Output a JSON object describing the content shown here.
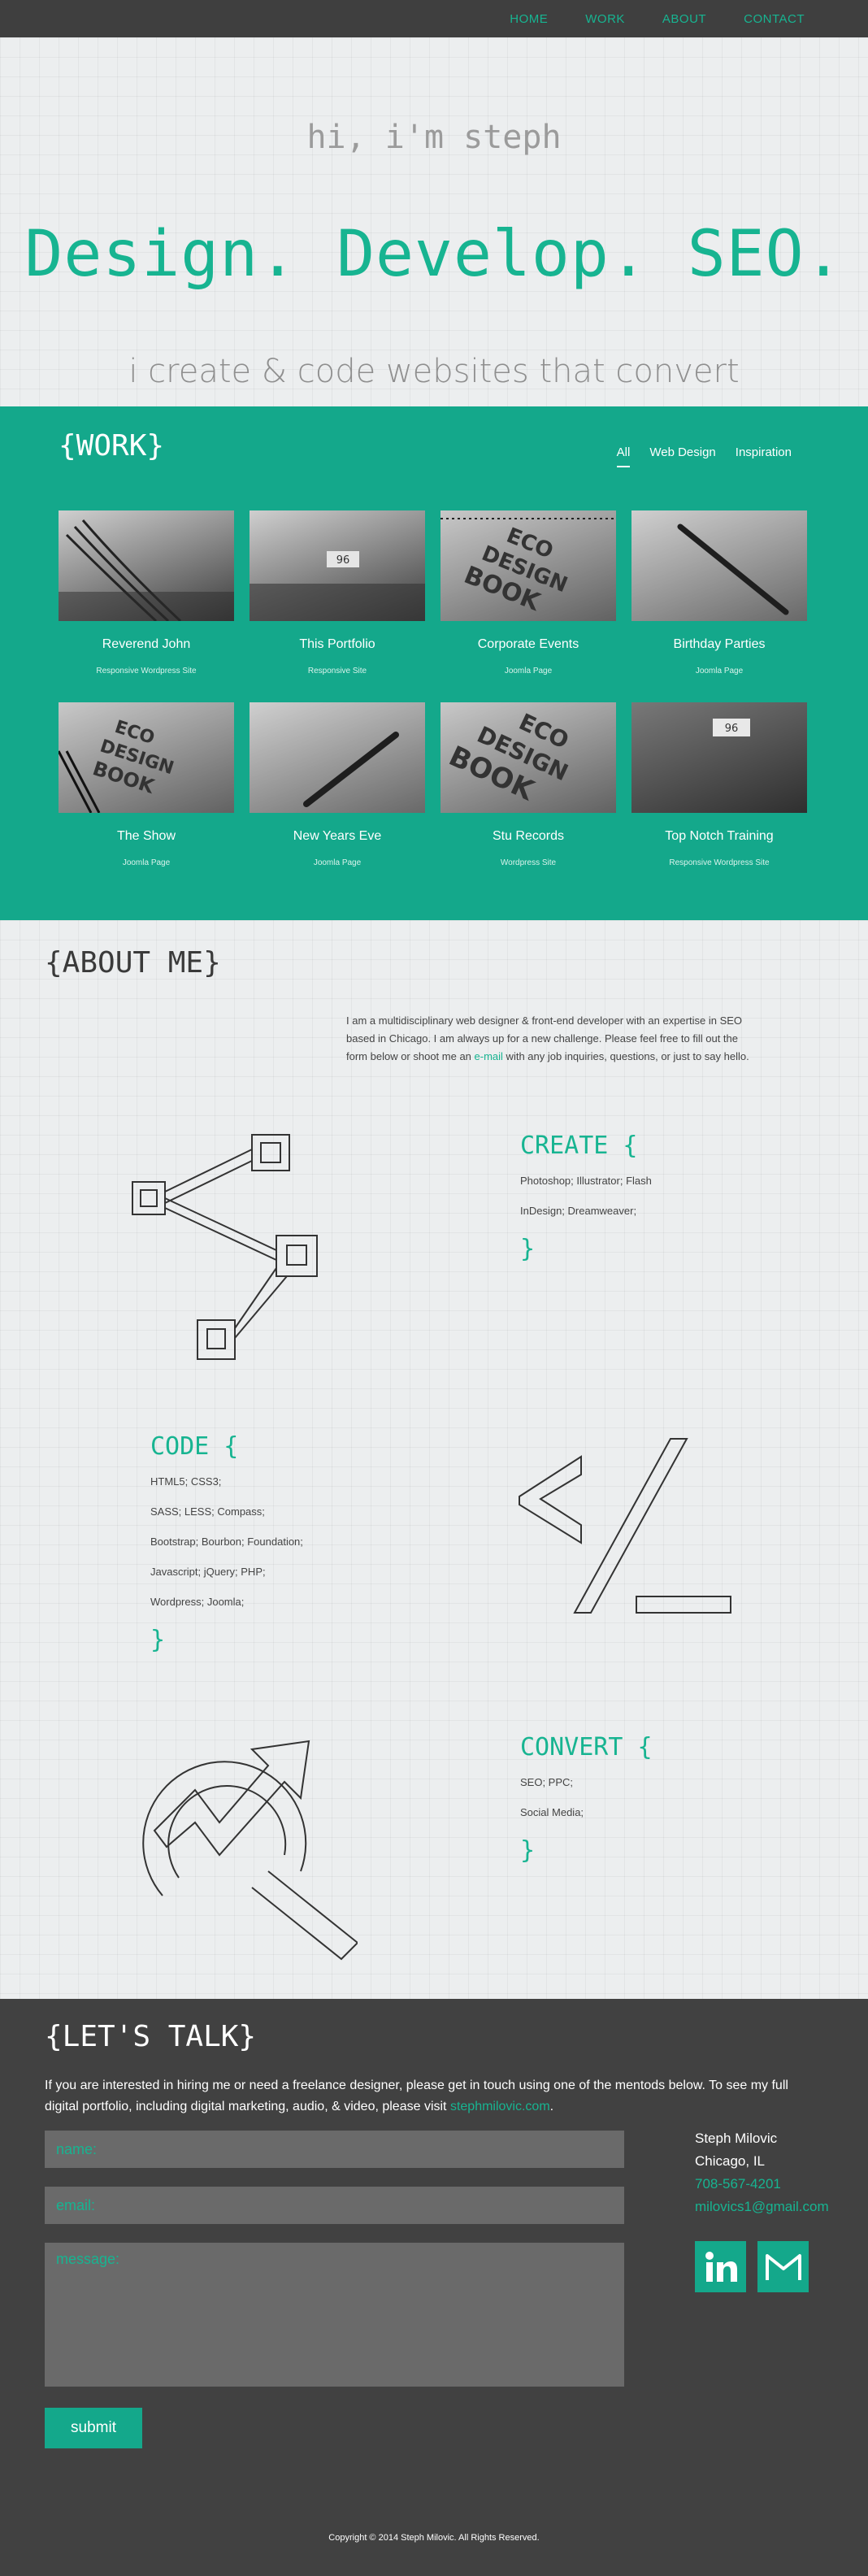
{
  "nav": {
    "items": [
      "HOME",
      "WORK",
      "ABOUT",
      "CONTACT"
    ]
  },
  "hero": {
    "greeting": "hi, i'm steph",
    "headline": "Design. Develop. SEO.",
    "tagline": "i create & code websites that convert"
  },
  "work": {
    "title": "{WORK}",
    "filters": [
      "All",
      "Web Design",
      "Inspiration"
    ],
    "active_filter": "All",
    "items": [
      {
        "name": "Reverend John",
        "sub": "Responsive Wordpress Site",
        "thumb": "spiral-notebook"
      },
      {
        "name": "This Portfolio",
        "sub": "Responsive Site",
        "thumb": "stamp-96"
      },
      {
        "name": "Corporate Events",
        "sub": "Joomla Page",
        "thumb": "eco-design-book"
      },
      {
        "name": "Birthday Parties",
        "sub": "Joomla Page",
        "thumb": "pen"
      },
      {
        "name": "The Show",
        "sub": "Joomla Page",
        "thumb": "eco-design-book"
      },
      {
        "name": "New Years Eve",
        "sub": "Joomla Page",
        "thumb": "pen"
      },
      {
        "name": "Stu Records",
        "sub": "Wordpress Site",
        "thumb": "eco-design-book"
      },
      {
        "name": "Top Notch Training",
        "sub": "Responsive Wordpress Site",
        "thumb": "stamp-96"
      }
    ]
  },
  "about": {
    "title": "{ABOUT ME}",
    "intro_before_link": "I am a multidisciplinary web designer & front-end developer with an expertise in SEO based in Chicago. I am always up for a new challenge. Please feel free to fill out the form below or shoot me an ",
    "intro_link": "e-mail",
    "intro_after_link": " with any job inquiries, questions, or just to say hello.",
    "skills": {
      "create": {
        "title": "CREATE {",
        "lines": [
          "Photoshop; Illustrator; Flash",
          "InDesign; Dreamweaver;"
        ],
        "close": "}"
      },
      "code": {
        "title": "CODE {",
        "lines": [
          "HTML5; CSS3;",
          "SASS; LESS; Compass;",
          "Bootstrap; Bourbon; Foundation;",
          "Javascript; jQuery; PHP;",
          "Wordpress; Joomla;"
        ],
        "close": "}"
      },
      "convert": {
        "title": "CONVERT {",
        "lines": [
          "SEO; PPC;",
          "Social Media;"
        ],
        "close": "}"
      }
    }
  },
  "contact": {
    "title": "{LET'S TALK}",
    "blurb_before_link": "If you are interested in hiring me or need a freelance designer, please get in touch using one of the mentods below. To see my full digital portfolio, including digital marketing, audio, & video, please visit ",
    "blurb_link": "stephmilovic.com",
    "blurb_after_link": ".",
    "name_placeholder": "name:",
    "email_placeholder": "email:",
    "message_placeholder": "message:",
    "submit_label": "submit",
    "info": {
      "name": "Steph Milovic",
      "city": "Chicago, IL",
      "phone": "708-567-4201",
      "email": "milovics1@gmail.com"
    },
    "socials": [
      "linkedin-icon",
      "gmail-icon"
    ],
    "copyright": "Copyright © 2014 Steph Milovic. All Rights Reserved."
  },
  "colors": {
    "accent": "#17b491",
    "work_bg": "#14a88b",
    "dark_bg": "#3f3f3f",
    "light_bg": "#eceeef"
  }
}
